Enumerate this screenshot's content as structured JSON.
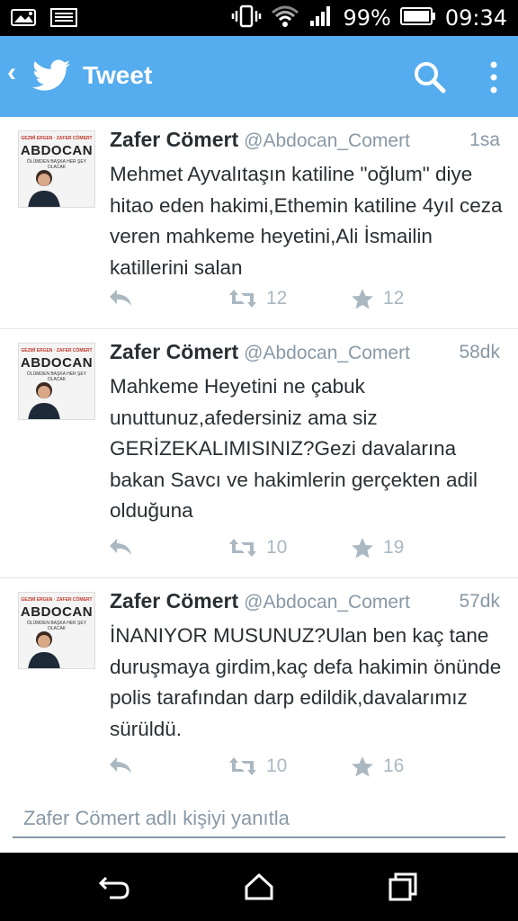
{
  "status_bar": {
    "battery_percent": "99%",
    "time": "09:34",
    "icons": [
      "image-icon",
      "sim-card-icon",
      "vibrate-icon",
      "wifi-icon",
      "signal-icon",
      "battery-icon"
    ]
  },
  "app_bar": {
    "title": "Tweet",
    "icons": [
      "back-icon",
      "twitter-bird-icon",
      "search-icon",
      "more-vert-icon"
    ],
    "background": "#55acee"
  },
  "tweets": [
    {
      "name": "Zafer Cömert",
      "handle": "@Abdocan_Comert",
      "time": "1sa",
      "text": "Mehmet Ayvalıtaşın katiline \"oğlum\" diye hitao eden hakimi,Ethemin katiline 4yıl ceza veren mahkeme heyetini,Ali İsmailin katillerini salan",
      "retweets": "12",
      "favorites": "12"
    },
    {
      "name": "Zafer Cömert",
      "handle": "@Abdocan_Comert",
      "time": "58dk",
      "text": "Mahkeme Heyetini ne çabuk unuttunuz,afedersiniz ama siz GERİZEKALIMISINIZ?Gezi davalarına bakan Savcı ve hakimlerin gerçekten adil olduğuna",
      "retweets": "10",
      "favorites": "19"
    },
    {
      "name": "Zafer Cömert",
      "handle": "@Abdocan_Comert",
      "time": "57dk",
      "text": "İNANIYOR MUSUNUZ?Ulan ben kaç tane duruşmaya girdim,kaç defa hakimin önünde polis tarafından darp edildik,davalarımız sürüldü.",
      "retweets": "10",
      "favorites": "16"
    }
  ],
  "avatar": {
    "top_text": "GEZMİ ERGEN · ZAFER CÖMERT",
    "logo": "ABDOCAN",
    "sub": "ÖLÜMDEN BAŞKA HER ŞEY OLACAK"
  },
  "reply": {
    "placeholder": "Zafer Cömert adlı kişiyi yanıtla"
  },
  "nav_bar": {
    "icons": [
      "back-nav-icon",
      "home-icon",
      "recent-apps-icon"
    ]
  },
  "colors": {
    "accent": "#55acee",
    "text": "#292f33",
    "muted": "#8899a6",
    "action": "#aab8c2"
  }
}
